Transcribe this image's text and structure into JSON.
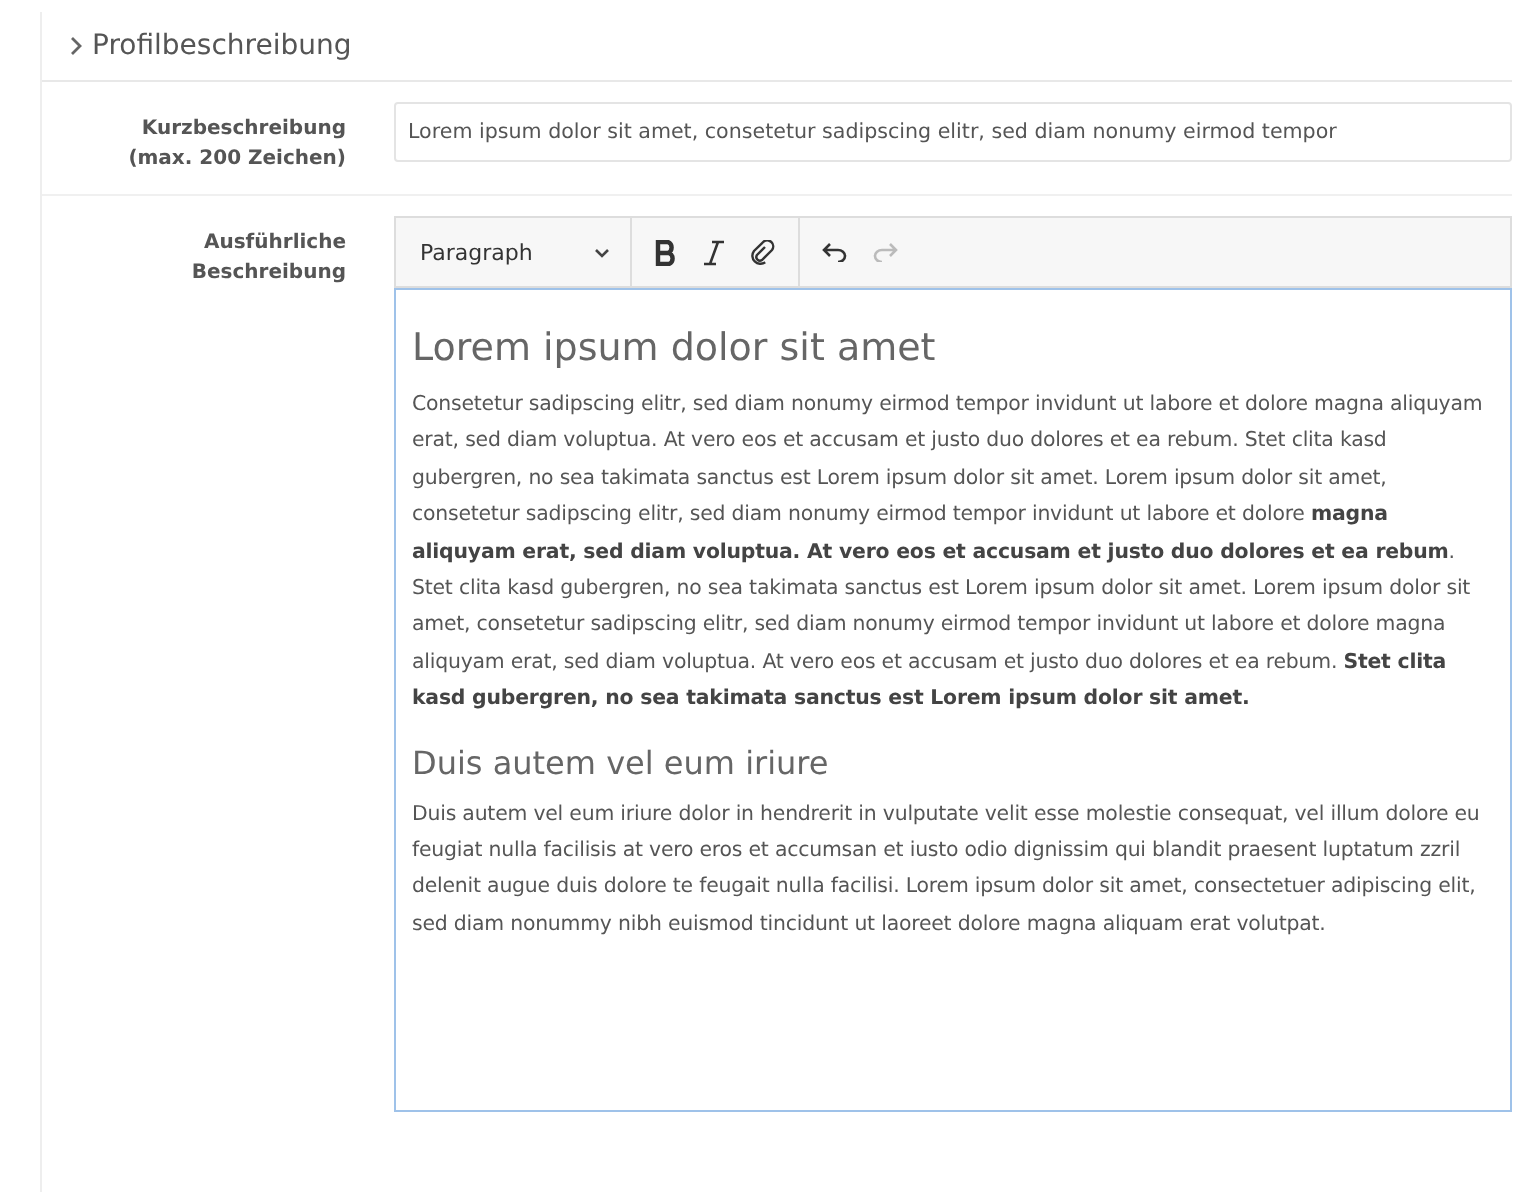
{
  "section": {
    "title": "Profilbeschreibung"
  },
  "fields": [
    {
      "kind": "text",
      "label": "Kurzbeschreibung (max. 200 Zeichen)",
      "value": "Lorem ipsum dolor sit amet, consetetur sadipscing elitr, sed diam nonumy eirmod tempor"
    },
    {
      "kind": "editor",
      "label": "Ausführliche Beschreibung",
      "toolbar": {
        "format": "Paragraph",
        "redo_disabled": true,
        "undo_disabled": false
      },
      "content": [
        {
          "kind": "heading",
          "text": "Lorem ipsum dolor sit amet"
        },
        {
          "kind": "paragraph",
          "text": "Consetetur sadipscing elitr, sed diam nonumy eirmod tempor invidunt ut labore et dolore magna aliquyam erat, sed diam voluptua. At vero eos et accusam et justo duo dolores et ea rebum. Stet clita kasd gubergren, no sea takimata sanctus est Lorem ipsum dolor sit amet. Lorem ipsum dolor sit amet, consetetur sadipscing elitr, sed diam nonumy eirmod tempor invidunt ut labore et dolore **magna aliquyam erat, sed diam voluptua. At vero eos et accusam et justo duo dolores et ea rebum**. Stet clita kasd gubergren, no sea takimata sanctus est Lorem ipsum dolor sit amet. Lorem ipsum dolor sit amet, consetetur sadipscing elitr, sed diam nonumy eirmod tempor invidunt ut labore et dolore magna aliquyam erat, sed diam voluptua. At vero eos et accusam et justo duo dolores et ea rebum. **Stet clita kasd gubergren, no sea takimata sanctus est Lorem ipsum dolor sit amet.**"
        },
        {
          "kind": "heading",
          "text": "Duis autem vel eum iriure"
        },
        {
          "kind": "paragraph",
          "text": "Duis autem vel eum iriure dolor in hendrerit in vulputate velit esse molestie consequat, vel illum dolore eu feugiat nulla facilisis at vero eros et accumsan et iusto odio dignissim qui blandit praesent luptatum zzril delenit augue duis dolore te feugait nulla facilisi. Lorem ipsum dolor sit amet, consectetuer adipiscing elit, sed diam nonummy nibh euismod tincidunt ut laoreet dolore magna aliquam erat volutpat."
        }
      ]
    }
  ]
}
